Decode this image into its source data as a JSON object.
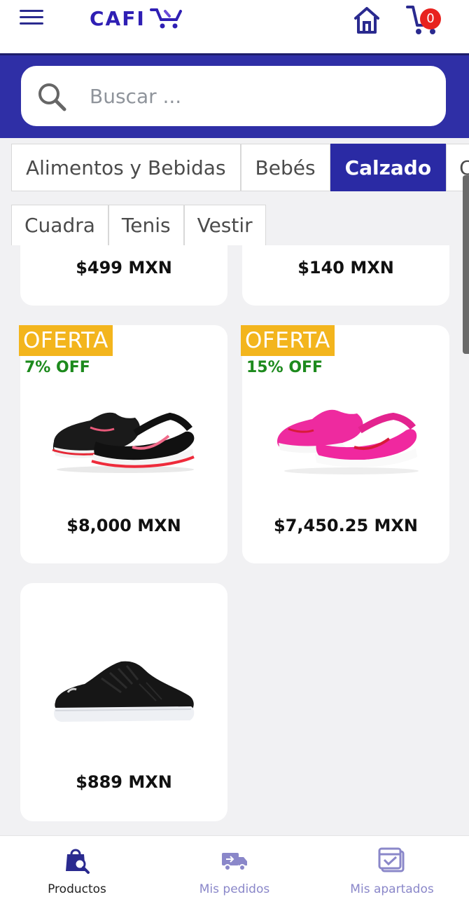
{
  "header": {
    "logo_text": "CAFI",
    "cart_count": "0",
    "brand_color": "#2f1fb4"
  },
  "search": {
    "placeholder": "Buscar ..."
  },
  "categories": {
    "tabs": [
      {
        "label": "Alimentos y Bebidas",
        "active": false
      },
      {
        "label": "Bebés",
        "active": false
      },
      {
        "label": "Calzado",
        "active": true
      },
      {
        "label": "Ce",
        "active": false
      }
    ],
    "subtabs": [
      {
        "label": "Cuadra"
      },
      {
        "label": "Tenis"
      },
      {
        "label": "Vestir"
      }
    ]
  },
  "products": [
    {
      "price": "$499 MXN"
    },
    {
      "price": "$140 MXN"
    },
    {
      "price": "$8,000 MXN",
      "offer": "OFERTA",
      "discount": "7% OFF",
      "image": "black-red-running-shoe"
    },
    {
      "price": "$7,450.25 MXN",
      "offer": "OFERTA",
      "discount": "15% OFF",
      "image": "pink-running-shoe"
    },
    {
      "price": "$889 MXN",
      "image": "black-leather-sneaker"
    }
  ],
  "bottom_nav": {
    "items": [
      {
        "label": "Productos",
        "icon": "shopping-bag-search-icon",
        "active": true
      },
      {
        "label": "Mis pedidos",
        "icon": "delivery-truck-icon",
        "active": false
      },
      {
        "label": "Mis apartados",
        "icon": "calendar-check-icon",
        "active": false
      }
    ]
  },
  "colors": {
    "primary": "#2f2fa6",
    "offer": "#f3b51d",
    "discount": "#1d8a1d",
    "badge": "#e8231f"
  }
}
